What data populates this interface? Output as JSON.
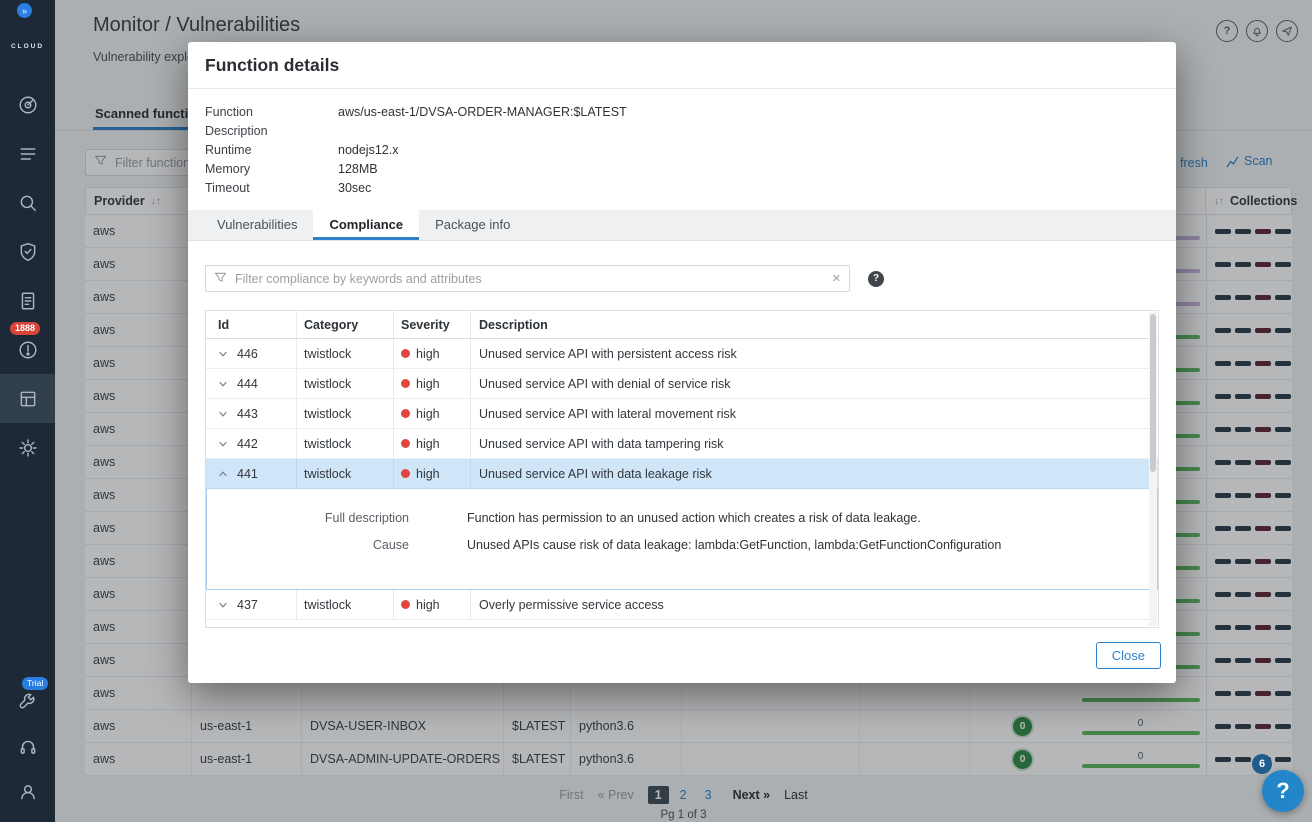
{
  "glyphs": {
    "help": "?",
    "clear": "✕",
    "sort": "↓↑"
  },
  "colors": {
    "accent": "#2f82c9",
    "severity_high_dot": "#e0463d",
    "bar_green": "#5eb75f",
    "bar_lavender": "#c9b4dc",
    "badge_green": "#2e8b45",
    "notification_badge": "#d8453a",
    "trial_badge": "#2a7de1",
    "collection_dashes": [
      "#2c3a49",
      "#2c3a49",
      "#5d2537",
      "#2c3a49"
    ]
  },
  "sidebar": {
    "logo_label": "CLOUD",
    "expand_badge": "»",
    "trial_label": "Trial",
    "items": [
      {
        "name": "radar-icon"
      },
      {
        "name": "policy-list-icon"
      },
      {
        "name": "search-icon"
      },
      {
        "name": "shield-check-icon"
      },
      {
        "name": "report-document-icon"
      },
      {
        "name": "alerts-icon",
        "badge": "1888"
      },
      {
        "name": "serverless-functions-icon",
        "selected": true
      },
      {
        "name": "settings-gear-icon"
      }
    ],
    "bottom_items": [
      {
        "name": "utilities-wrench-icon",
        "badge": "Trial"
      },
      {
        "name": "support-headset-icon"
      },
      {
        "name": "profile-user-icon"
      }
    ]
  },
  "header": {
    "breadcrumb": "Monitor / Vulnerabilities",
    "subtitle": "Vulnerability explor"
  },
  "toolbar": {
    "refresh_label": "fresh",
    "scan_label": "Scan"
  },
  "background": {
    "tab_label": "Scanned functions",
    "filter_placeholder": "Filter functions by",
    "columns": {
      "provider": "Provider",
      "collections": "Collections"
    },
    "rows": [
      {
        "provider": "aws",
        "region": "",
        "function": "",
        "version": "",
        "runtime": "",
        "vulnerabilities": "",
        "compliance": "",
        "bar": "lavender"
      },
      {
        "provider": "aws",
        "region": "",
        "function": "",
        "version": "",
        "runtime": "",
        "vulnerabilities": "",
        "compliance": "",
        "bar": "lavender"
      },
      {
        "provider": "aws",
        "region": "",
        "function": "",
        "version": "",
        "runtime": "",
        "vulnerabilities": "",
        "compliance": "",
        "bar": "lavender"
      },
      {
        "provider": "aws",
        "region": "",
        "function": "",
        "version": "",
        "runtime": "",
        "vulnerabilities": "",
        "compliance": "",
        "bar": "green"
      },
      {
        "provider": "aws",
        "region": "",
        "function": "",
        "version": "",
        "runtime": "",
        "vulnerabilities": "",
        "compliance": "",
        "bar": "green"
      },
      {
        "provider": "aws",
        "region": "",
        "function": "",
        "version": "",
        "runtime": "",
        "vulnerabilities": "",
        "compliance": "",
        "bar": "green"
      },
      {
        "provider": "aws",
        "region": "",
        "function": "",
        "version": "",
        "runtime": "",
        "vulnerabilities": "",
        "compliance": "",
        "bar": "green"
      },
      {
        "provider": "aws",
        "region": "",
        "function": "",
        "version": "",
        "runtime": "",
        "vulnerabilities": "",
        "compliance": "",
        "bar": "green"
      },
      {
        "provider": "aws",
        "region": "",
        "function": "",
        "version": "",
        "runtime": "",
        "vulnerabilities": "",
        "compliance": "",
        "bar": "green"
      },
      {
        "provider": "aws",
        "region": "",
        "function": "",
        "version": "",
        "runtime": "",
        "vulnerabilities": "",
        "compliance": "",
        "bar": "green"
      },
      {
        "provider": "aws",
        "region": "",
        "function": "",
        "version": "",
        "runtime": "",
        "vulnerabilities": "",
        "compliance": "",
        "bar": "green"
      },
      {
        "provider": "aws",
        "region": "",
        "function": "",
        "version": "",
        "runtime": "",
        "vulnerabilities": "",
        "compliance": "",
        "bar": "green"
      },
      {
        "provider": "aws",
        "region": "",
        "function": "",
        "version": "",
        "runtime": "",
        "vulnerabilities": "",
        "compliance": "",
        "bar": "green"
      },
      {
        "provider": "aws",
        "region": "",
        "function": "",
        "version": "",
        "runtime": "",
        "vulnerabilities": "",
        "compliance": "",
        "bar": "green"
      },
      {
        "provider": "aws",
        "region": "",
        "function": "",
        "version": "",
        "runtime": "",
        "vulnerabilities": "",
        "compliance": "",
        "bar": "green"
      },
      {
        "provider": "aws",
        "region": "us-east-1",
        "function": "DVSA-USER-INBOX",
        "version": "$LATEST",
        "runtime": "python3.6",
        "vulnerabilities": "0",
        "compliance": "0",
        "bar": "green"
      },
      {
        "provider": "aws",
        "region": "us-east-1",
        "function": "DVSA-ADMIN-UPDATE-ORDERS",
        "version": "$LATEST",
        "runtime": "python3.6",
        "vulnerabilities": "0",
        "compliance": "0",
        "bar": "green"
      }
    ]
  },
  "modal": {
    "title": "Function details",
    "details": [
      {
        "label": "Function",
        "value": "aws/us-east-1/DVSA-ORDER-MANAGER:$LATEST"
      },
      {
        "label": "Description",
        "value": ""
      },
      {
        "label": "Runtime",
        "value": "nodejs12.x"
      },
      {
        "label": "Memory",
        "value": "128MB"
      },
      {
        "label": "Timeout",
        "value": "30sec"
      }
    ],
    "tabs": [
      {
        "label": "Vulnerabilities",
        "active": false
      },
      {
        "label": "Compliance",
        "active": true
      },
      {
        "label": "Package info",
        "active": false
      }
    ],
    "filter_placeholder": "Filter compliance by keywords and attributes",
    "table": {
      "columns": [
        "Id",
        "Category",
        "Severity",
        "Description"
      ],
      "rows": [
        {
          "id": "446",
          "category": "twistlock",
          "severity": "high",
          "description": "Unused service API with persistent access risk",
          "expanded": false
        },
        {
          "id": "444",
          "category": "twistlock",
          "severity": "high",
          "description": "Unused service API with denial of service risk",
          "expanded": false
        },
        {
          "id": "443",
          "category": "twistlock",
          "severity": "high",
          "description": "Unused service API with lateral movement risk",
          "expanded": false
        },
        {
          "id": "442",
          "category": "twistlock",
          "severity": "high",
          "description": "Unused service API with data tampering risk",
          "expanded": false
        },
        {
          "id": "441",
          "category": "twistlock",
          "severity": "high",
          "description": "Unused service API with data leakage risk",
          "expanded": true,
          "details": [
            {
              "label": "Full description",
              "value": "Function has permission to an unused action which creates a risk of data leakage."
            },
            {
              "label": "Cause",
              "value": "Unused APIs cause risk of data leakage: lambda:GetFunction, lambda:GetFunctionConfiguration"
            }
          ]
        },
        {
          "id": "437",
          "category": "twistlock",
          "severity": "high",
          "description": "Overly permissive service access",
          "expanded": false
        }
      ]
    },
    "close_label": "Close"
  },
  "pagination": {
    "first": "First",
    "prev": "« Prev",
    "pages": [
      "1",
      "2",
      "3"
    ],
    "active_page": "1",
    "next": "Next »",
    "last": "Last",
    "summary": "Pg 1 of 3"
  },
  "help_button": {
    "label": "?",
    "badge": "6"
  }
}
